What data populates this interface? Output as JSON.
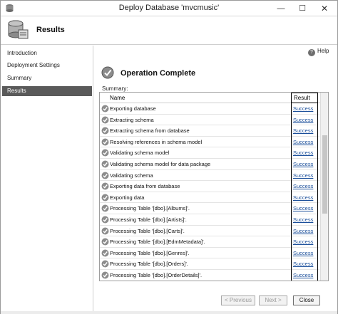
{
  "window": {
    "title": "Deploy Database 'mvcmusic'",
    "minimize_glyph": "—",
    "maximize_glyph": "☐",
    "close_glyph": "✕"
  },
  "header": {
    "title": "Results"
  },
  "sidebar": {
    "items": [
      {
        "label": "Introduction"
      },
      {
        "label": "Deployment Settings"
      },
      {
        "label": "Summary"
      },
      {
        "label": "Results",
        "active": true
      }
    ]
  },
  "help": {
    "label": "Help"
  },
  "status": {
    "title": "Operation Complete"
  },
  "summary": {
    "label": "Summary:",
    "columns": [
      "Name",
      "Result"
    ],
    "rows": [
      {
        "name": "Exporting database",
        "result": "Success"
      },
      {
        "name": "Extracting schema",
        "result": "Success"
      },
      {
        "name": "Extracting schema from database",
        "result": "Success"
      },
      {
        "name": "Resolving references in schema model",
        "result": "Success"
      },
      {
        "name": "Validating schema model",
        "result": "Success"
      },
      {
        "name": "Validating schema model for data package",
        "result": "Success"
      },
      {
        "name": "Validating schema",
        "result": "Success"
      },
      {
        "name": "Exporting data from database",
        "result": "Success"
      },
      {
        "name": "Exporting data",
        "result": "Success"
      },
      {
        "name": "Processing Table '[dbo].[Albums]'.",
        "result": "Success"
      },
      {
        "name": "Processing Table '[dbo].[Artists]'.",
        "result": "Success"
      },
      {
        "name": "Processing Table '[dbo].[Carts]'.",
        "result": "Success"
      },
      {
        "name": "Processing Table '[dbo].[EdmMetadata]'.",
        "result": "Success"
      },
      {
        "name": "Processing Table '[dbo].[Genres]'.",
        "result": "Success"
      },
      {
        "name": "Processing Table '[dbo].[Orders]'.",
        "result": "Success"
      },
      {
        "name": "Processing Table '[dbo].[OrderDetails]'.",
        "result": "Success"
      }
    ]
  },
  "footer": {
    "previous_label": "< Previous",
    "next_label": "Next >",
    "close_label": "Close"
  },
  "colors": {
    "active_sidebar": "#5a5a5a",
    "link": "#1a4e9a"
  }
}
